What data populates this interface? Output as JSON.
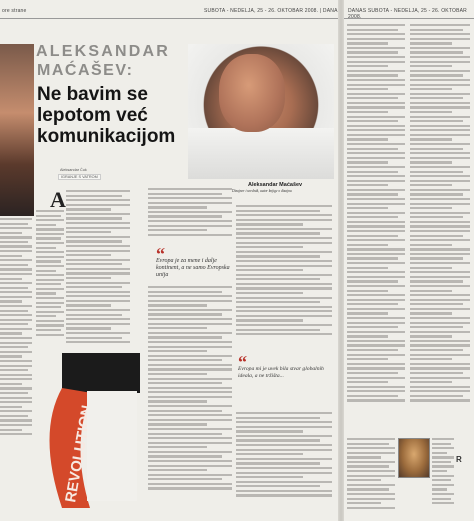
{
  "header": {
    "left_section": "ore strane",
    "left_dateline": "SUBOTA - NEDELJA, 25 - 26. OKTOBAR 2008. | DANAS",
    "right_dateline": "DANAS SUBOTA - NEDELJA, 25 - 26. OKTOBAR 2008."
  },
  "article": {
    "name": "ALEKSANDAR",
    "surname": "MAĆAŠEV:",
    "headline": "Ne bavim se lepotom već komunikacijom",
    "byline": "Aleksandar Ćuk",
    "rubric": "IGRANJE S VATROM",
    "dropcap": "A",
    "pull_quote_1": "Evropa je za mene i dalje kontinent, a ne samo Evropska unija",
    "pull_quote_2": "Evropa mi je uvek bila stvar globalnih ideala, a ne tržišta...",
    "photo_caption_name": "Aleksandar Maćašev",
    "photo_caption_text": "Dizajner i urednik, autor knjige o dizajnu"
  },
  "graphic": {
    "word": "REVOLUTION",
    "accent_color": "#d4492a"
  },
  "colors": {
    "headline": "#151515",
    "name": "#8d8c89",
    "quote_mark": "#b8322a"
  },
  "side_mark": "R"
}
